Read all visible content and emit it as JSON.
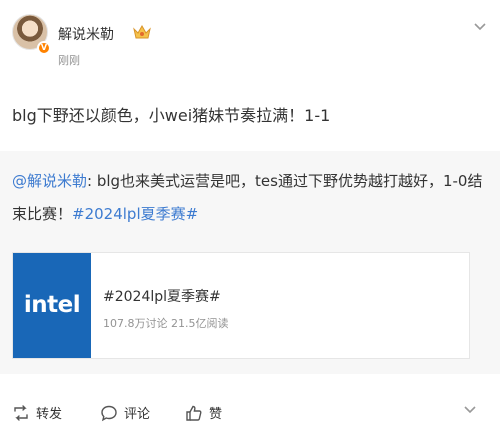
{
  "author": {
    "name": "解说米勒",
    "time": "刚刚"
  },
  "post": {
    "text": "blg下野还以颜色，小wei猪妹节奏拉满！1-1"
  },
  "retweet": {
    "mention": "@解说米勒",
    "text": ": blg也来美式运营是吧，tes通过下野优势越打越好，1-0结束比赛！",
    "topic": "#2024lpl夏季赛#"
  },
  "card": {
    "logo_text": "intel",
    "title": "#2024lpl夏季赛#",
    "meta": "107.8万讨论 21.5亿阅读"
  },
  "actions": {
    "repost": "转发",
    "comment": "评论",
    "like": "赞"
  },
  "colors": {
    "link": "#3d7bd0",
    "card_logo_bg": "#1967b7",
    "badge": "#ff8200",
    "retweet_bg": "#f7f7f7"
  }
}
